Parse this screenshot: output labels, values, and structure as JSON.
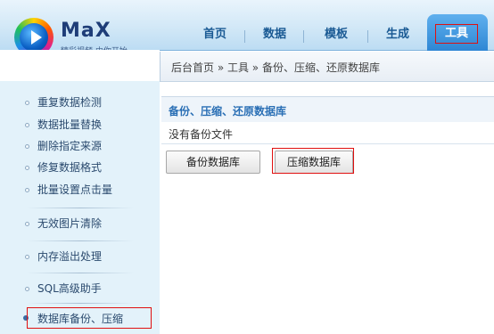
{
  "brand": {
    "name": "MaX",
    "slogan": "精彩视频 由你开始",
    "colors": {
      "header_bg": "#d2e8f7",
      "nav_active": "#2e86d4",
      "highlight_border": "#e01010",
      "sidebar_bg": "#e3f2fa"
    }
  },
  "nav": {
    "items": [
      "首页",
      "数据",
      "模板",
      "生成"
    ],
    "active": "工具"
  },
  "breadcrumb": "后台首页 » 工具 » 备份、压缩、还原数据库",
  "sidebar": {
    "items": [
      "重复数据检测",
      "数据批量替换",
      "删除指定来源",
      "修复数据格式",
      "批量设置点击量",
      "无效图片清除",
      "内存溢出处理",
      "SQL高级助手",
      "数据库备份、压缩"
    ],
    "active_index": 8
  },
  "panel": {
    "title": "备份、压缩、还原数据库",
    "status": "没有备份文件",
    "backup_label": "备份数据库",
    "compress_label": "压缩数据库"
  }
}
